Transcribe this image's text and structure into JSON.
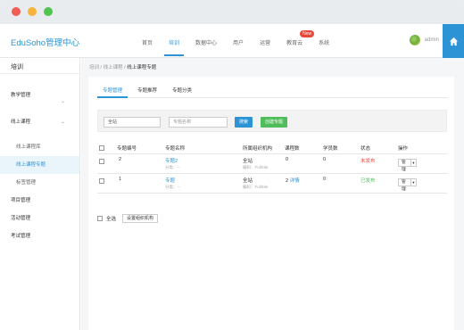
{
  "header": {
    "logo": "EduSoho管理中心",
    "nav": [
      {
        "label": "首页"
      },
      {
        "label": "培训"
      },
      {
        "label": "数据中心"
      },
      {
        "label": "用户"
      },
      {
        "label": "运营"
      },
      {
        "label": "教育云"
      },
      {
        "label": "系统"
      }
    ],
    "new_badge": "New",
    "username": "admin"
  },
  "sidebar": {
    "title": "培训",
    "items": [
      {
        "label": "教学管理"
      },
      {
        "label": "线上课程"
      },
      {
        "label": "线上课程库"
      },
      {
        "label": "线上课程专题"
      },
      {
        "label": "标签管理"
      },
      {
        "label": "项目管理"
      },
      {
        "label": "活动管理"
      },
      {
        "label": "考试管理"
      }
    ]
  },
  "breadcrumb": {
    "parts": [
      "培训",
      "线上课程"
    ],
    "separator": "/",
    "current": "线上课程专题"
  },
  "tabs": [
    {
      "label": "专题管理"
    },
    {
      "label": "专题推荐"
    },
    {
      "label": "专题分类"
    }
  ],
  "filters": {
    "org_value": "全站",
    "name_placeholder": "专题名称",
    "search_label": "搜索",
    "create_label": "创建专题"
  },
  "table": {
    "headers": [
      "专题编号",
      "专题名称",
      "所属组织机构",
      "课程数",
      "学员数",
      "状态",
      "操作"
    ],
    "rows": [
      {
        "id": "2",
        "name": "专题2",
        "sort": "分类：--",
        "org": "全站",
        "org_code": "编码：FullSite",
        "courses": "0",
        "students": "0",
        "status": "未发布",
        "action": "管理"
      },
      {
        "id": "1",
        "name": "专题",
        "sort": "分类：--",
        "org": "全站",
        "org_code": "编码：FullSite",
        "courses": "2",
        "courses_detail": "详情",
        "students": "0",
        "status": "已发布",
        "action": "管理"
      }
    ]
  },
  "bottom": {
    "select_all": "全选",
    "set_org": "设置组织机构"
  },
  "colors": {
    "accent": "#2c93d5",
    "success": "#4ebd5a",
    "danger": "#e8473b"
  }
}
